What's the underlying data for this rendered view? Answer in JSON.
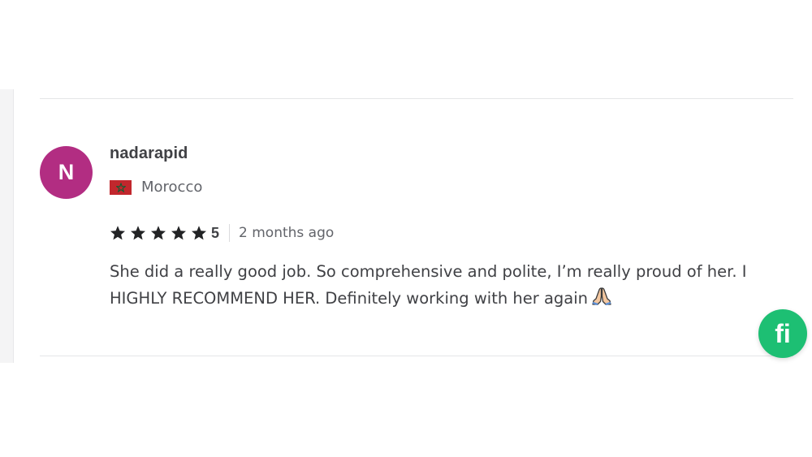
{
  "review": {
    "avatar_initial": "N",
    "username": "nadarapid",
    "country": "Morocco",
    "flag_icon": "morocco-flag-icon",
    "rating": 5,
    "rating_label": "5",
    "time_ago": "2 months ago",
    "text": "She did a really good job. So comprehensive and polite, I’m really proud of her. I HIGHLY RECOMMEND HER. Definitely working with her again",
    "emoji_icon": "folded-hands-icon"
  },
  "fab": {
    "label": "fi",
    "icon": "fiverr-logo-icon"
  },
  "colors": {
    "avatar_bg": "#b22d82",
    "star": "#222325",
    "text": "#404145",
    "muted": "#62646a",
    "fab_bg": "#1dbf73",
    "flag_red": "#c1272d",
    "flag_green": "#006233"
  }
}
